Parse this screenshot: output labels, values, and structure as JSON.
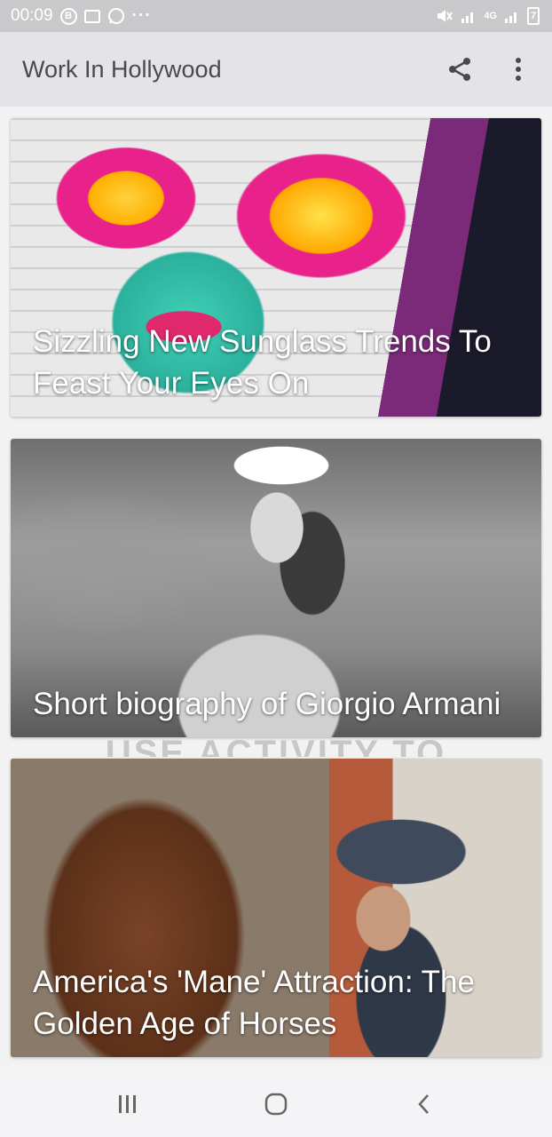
{
  "status_bar": {
    "time": "00:09",
    "left_icons": [
      "b-circle-icon",
      "gallery-icon",
      "whatsapp-icon",
      "more-dots-icon"
    ],
    "more_dots": "···",
    "right_icons": [
      "mute-icon",
      "signal-icon",
      "4g-icon",
      "signal-icon",
      "battery-icon"
    ],
    "network": "4G",
    "battery": "7"
  },
  "app_bar": {
    "title": "Work In Hollywood",
    "share_icon": "share-icon",
    "menu_icon": "more-vert-icon"
  },
  "feed": {
    "articles": [
      {
        "title": "Sizzling New Sunglass Trends To Feast Your Eyes On",
        "image": "graffiti-sunglasses-mural"
      },
      {
        "title": "Short biography of Giorgio Armani",
        "image": "woman-white-hat-bw"
      },
      {
        "title": "America's 'Mane' Attraction: The Golden Age of Horses",
        "image": "horse-and-man-hat"
      }
    ],
    "overlay_text": "USE ACTIVITY TO"
  },
  "nav_bar": {
    "recents_icon": "recents-icon",
    "home_icon": "home-icon",
    "back_icon": "back-icon"
  },
  "colors": {
    "status_bar": "#c9c9cc",
    "app_bar": "#e4e4e8",
    "title_text": "#4a4a4c",
    "card_title": "#ffffff",
    "nav_bar": "#f4f4f6"
  }
}
